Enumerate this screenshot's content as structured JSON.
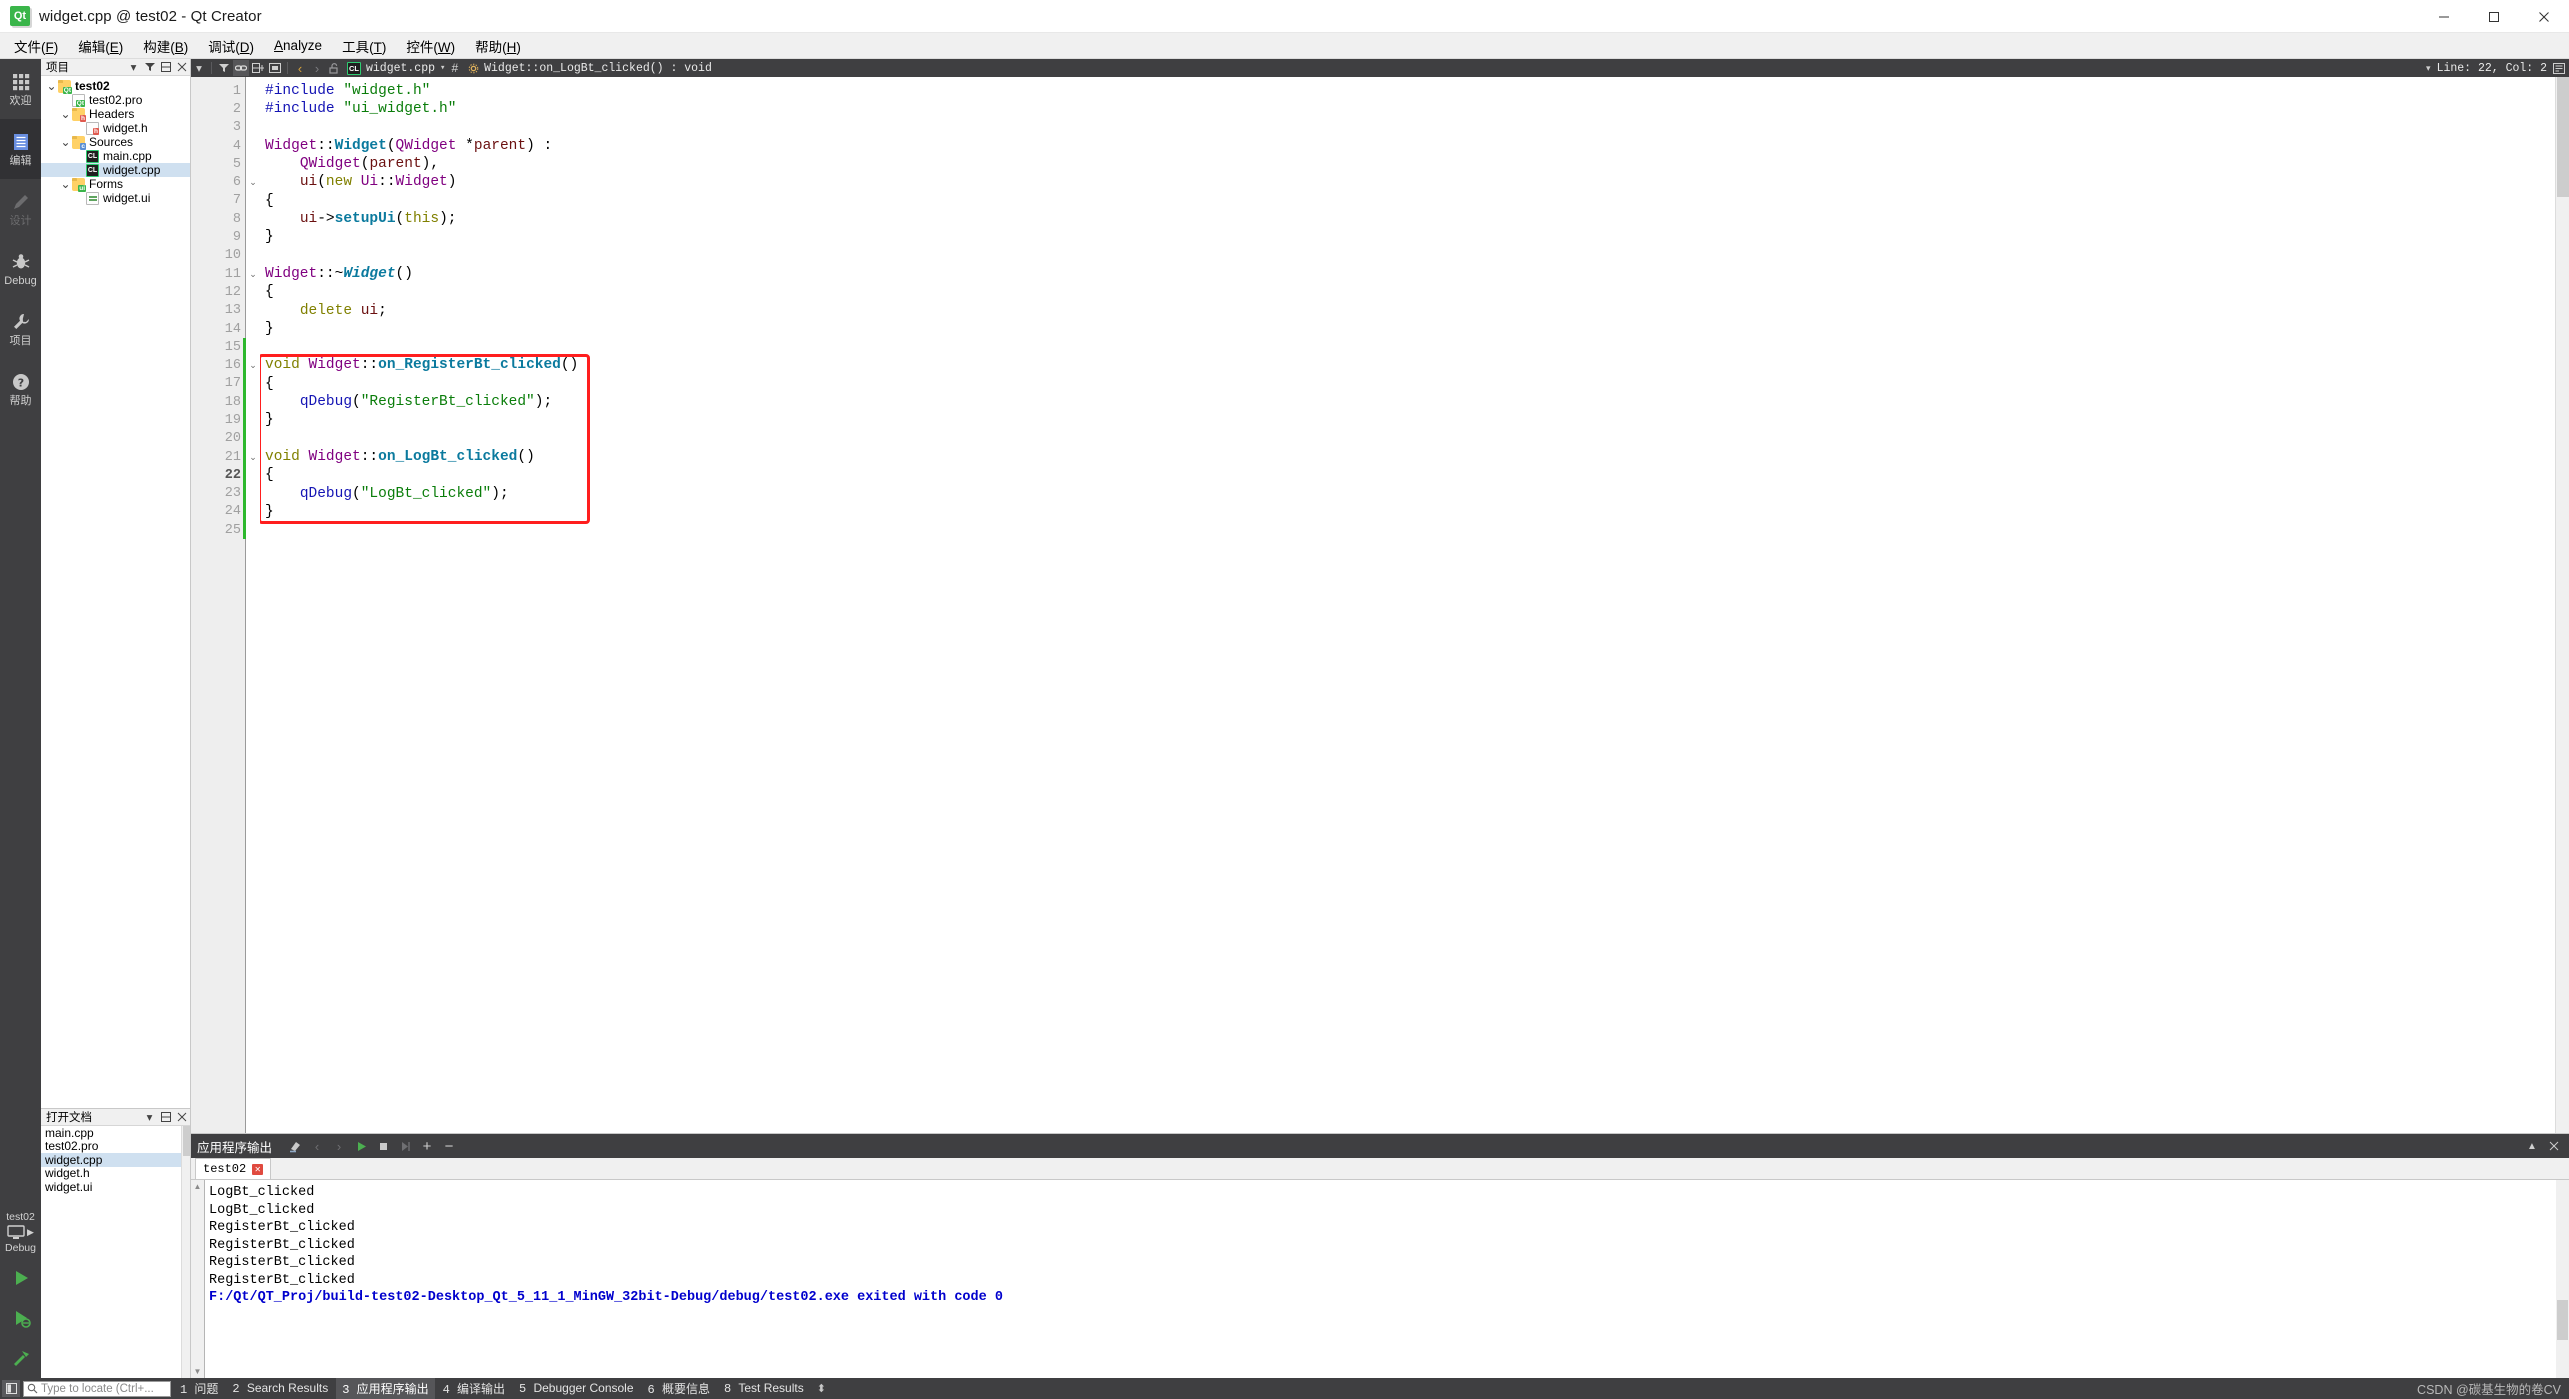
{
  "window": {
    "title": "widget.cpp @ test02 - Qt Creator",
    "app_icon": "qt-logo-icon",
    "minimize": "minimize-icon",
    "maximize": "maximize-icon",
    "close": "close-icon"
  },
  "menubar": {
    "items": [
      {
        "label": "文件(F)",
        "text": "文件(",
        "mnemonic": "F",
        "tail": ")"
      },
      {
        "label": "编辑(E)",
        "text": "编辑(",
        "mnemonic": "E",
        "tail": ")"
      },
      {
        "label": "构建(B)",
        "text": "构建(",
        "mnemonic": "B",
        "tail": ")"
      },
      {
        "label": "调试(D)",
        "text": "调试(",
        "mnemonic": "D",
        "tail": ")"
      },
      {
        "label": "Analyze",
        "text": "",
        "mnemonic": "A",
        "tail": "nalyze"
      },
      {
        "label": "工具(T)",
        "text": "工具(",
        "mnemonic": "T",
        "tail": ")"
      },
      {
        "label": "控件(W)",
        "text": "控件(",
        "mnemonic": "W",
        "tail": ")"
      },
      {
        "label": "帮助(H)",
        "text": "帮助(",
        "mnemonic": "H",
        "tail": ")"
      }
    ]
  },
  "modebar": {
    "items": [
      {
        "label": "欢迎",
        "icon": "grid-icon",
        "state": "normal"
      },
      {
        "label": "编辑",
        "icon": "document-icon",
        "state": "active"
      },
      {
        "label": "设计",
        "icon": "pencil-icon",
        "state": "disabled"
      },
      {
        "label": "Debug",
        "icon": "bug-icon",
        "state": "normal"
      },
      {
        "label": "项目",
        "icon": "wrench-icon",
        "state": "normal"
      },
      {
        "label": "帮助",
        "icon": "question-icon",
        "state": "normal"
      }
    ],
    "kit": {
      "project": "test02",
      "icon": "desktop-icon",
      "config": "Debug",
      "run_icon": "run-icon",
      "debug_icon": "debug-run-icon",
      "build_icon": "build-hammer-icon"
    }
  },
  "projects_pane": {
    "title": "项目",
    "filter_icon": "filter-icon",
    "dropdown_icon": "chevron-down-icon",
    "split_icon": "split-icon",
    "close_icon": "close-icon",
    "tree": [
      {
        "label": "test02",
        "depth": 0,
        "icon": "folder-qt-icon",
        "arrow": "down",
        "bold": true,
        "selected": false
      },
      {
        "label": "test02.pro",
        "depth": 1,
        "icon": "file-pro-icon",
        "arrow": "none",
        "bold": false,
        "selected": false
      },
      {
        "label": "Headers",
        "depth": 1,
        "icon": "folder-h-icon",
        "arrow": "down",
        "bold": false,
        "selected": false
      },
      {
        "label": "widget.h",
        "depth": 2,
        "icon": "file-h-icon",
        "arrow": "none",
        "bold": false,
        "selected": false
      },
      {
        "label": "Sources",
        "depth": 1,
        "icon": "folder-cpp-icon",
        "arrow": "down",
        "bold": false,
        "selected": false
      },
      {
        "label": "main.cpp",
        "depth": 2,
        "icon": "file-cl-icon",
        "arrow": "none",
        "bold": false,
        "selected": false
      },
      {
        "label": "widget.cpp",
        "depth": 2,
        "icon": "file-cl-icon",
        "arrow": "none",
        "bold": false,
        "selected": true
      },
      {
        "label": "Forms",
        "depth": 1,
        "icon": "folder-ui-icon",
        "arrow": "down",
        "bold": false,
        "selected": false
      },
      {
        "label": "widget.ui",
        "depth": 2,
        "icon": "file-ui-icon",
        "arrow": "none",
        "bold": false,
        "selected": false
      }
    ]
  },
  "open_documents": {
    "title": "打开文档",
    "dropdown_icon": "chevron-down-icon",
    "split_icon": "split-icon",
    "close_icon": "close-icon",
    "items": [
      {
        "label": "main.cpp",
        "selected": false
      },
      {
        "label": "test02.pro",
        "selected": false
      },
      {
        "label": "widget.cpp",
        "selected": true
      },
      {
        "label": "widget.h",
        "selected": false
      },
      {
        "label": "widget.ui",
        "selected": false
      }
    ]
  },
  "editor_toolbar": {
    "dropdown_icon": "chevron-down-icon",
    "filter_icon": "filter-icon",
    "link_icon": "link-icon",
    "split_icon": "split-horizontal-icon",
    "close_split_icon": "close-split-icon",
    "back_icon": "back-arrow-icon",
    "forward_icon": "forward-arrow-icon",
    "lock_icon": "unlocked-icon",
    "file_icon": "cl-file-icon",
    "filename": "widget.cpp",
    "separator": "#",
    "symbol": "Widget::on_LogBt_clicked() : void",
    "line_col": "Line: 22, Col: 2",
    "right_dropdown_icon": "chevron-down-icon",
    "outline_icon": "outline-icon"
  },
  "code": {
    "cursor_line": 22,
    "first_line": 1,
    "last_line": 25,
    "changed_lines": [
      15,
      16,
      17,
      18,
      19,
      20,
      21,
      22,
      23,
      24,
      25
    ],
    "fold_lines": [
      6,
      11,
      16,
      21
    ],
    "lines": [
      {
        "n": 1,
        "tokens": [
          {
            "t": "#include ",
            "c": "t-pre"
          },
          {
            "t": "\"widget.h\"",
            "c": "t-str"
          }
        ]
      },
      {
        "n": 2,
        "tokens": [
          {
            "t": "#include ",
            "c": "t-pre"
          },
          {
            "t": "\"ui_widget.h\"",
            "c": "t-str"
          }
        ]
      },
      {
        "n": 3,
        "tokens": []
      },
      {
        "n": 4,
        "tokens": [
          {
            "t": "Widget",
            "c": "t-type"
          },
          {
            "t": "::",
            "c": "t-op"
          },
          {
            "t": "Widget",
            "c": "t-func"
          },
          {
            "t": "(",
            "c": "t-op"
          },
          {
            "t": "QWidget",
            "c": "t-type"
          },
          {
            "t": " *",
            "c": "t-op"
          },
          {
            "t": "parent",
            "c": "t-var"
          },
          {
            "t": ") :",
            "c": "t-op"
          }
        ]
      },
      {
        "n": 5,
        "tokens": [
          {
            "t": "    ",
            "c": "t-plain"
          },
          {
            "t": "QWidget",
            "c": "t-type"
          },
          {
            "t": "(",
            "c": "t-op"
          },
          {
            "t": "parent",
            "c": "t-var"
          },
          {
            "t": "),",
            "c": "t-op"
          }
        ]
      },
      {
        "n": 6,
        "tokens": [
          {
            "t": "    ",
            "c": "t-plain"
          },
          {
            "t": "ui",
            "c": "t-var"
          },
          {
            "t": "(",
            "c": "t-op"
          },
          {
            "t": "new",
            "c": "t-kw"
          },
          {
            "t": " ",
            "c": "t-plain"
          },
          {
            "t": "Ui",
            "c": "t-type"
          },
          {
            "t": "::",
            "c": "t-op"
          },
          {
            "t": "Widget",
            "c": "t-type"
          },
          {
            "t": ")",
            "c": "t-op"
          }
        ]
      },
      {
        "n": 7,
        "tokens": [
          {
            "t": "{",
            "c": "t-op"
          }
        ]
      },
      {
        "n": 8,
        "tokens": [
          {
            "t": "    ",
            "c": "t-plain"
          },
          {
            "t": "ui",
            "c": "t-var"
          },
          {
            "t": "->",
            "c": "t-op"
          },
          {
            "t": "setupUi",
            "c": "t-func"
          },
          {
            "t": "(",
            "c": "t-op"
          },
          {
            "t": "this",
            "c": "t-kw"
          },
          {
            "t": ");",
            "c": "t-op"
          }
        ]
      },
      {
        "n": 9,
        "tokens": [
          {
            "t": "}",
            "c": "t-op"
          }
        ]
      },
      {
        "n": 10,
        "tokens": []
      },
      {
        "n": 11,
        "tokens": [
          {
            "t": "Widget",
            "c": "t-type"
          },
          {
            "t": "::~",
            "c": "t-op"
          },
          {
            "t": "Widget",
            "c": "t-funcd"
          },
          {
            "t": "()",
            "c": "t-op"
          }
        ]
      },
      {
        "n": 12,
        "tokens": [
          {
            "t": "{",
            "c": "t-op"
          }
        ]
      },
      {
        "n": 13,
        "tokens": [
          {
            "t": "    ",
            "c": "t-plain"
          },
          {
            "t": "delete",
            "c": "t-kw"
          },
          {
            "t": " ",
            "c": "t-plain"
          },
          {
            "t": "ui",
            "c": "t-var"
          },
          {
            "t": ";",
            "c": "t-op"
          }
        ]
      },
      {
        "n": 14,
        "tokens": [
          {
            "t": "}",
            "c": "t-op"
          }
        ]
      },
      {
        "n": 15,
        "tokens": []
      },
      {
        "n": 16,
        "tokens": [
          {
            "t": "void",
            "c": "t-kw"
          },
          {
            "t": " ",
            "c": "t-plain"
          },
          {
            "t": "Widget",
            "c": "t-type"
          },
          {
            "t": "::",
            "c": "t-op"
          },
          {
            "t": "on_RegisterBt_clicked",
            "c": "t-func"
          },
          {
            "t": "()",
            "c": "t-op"
          }
        ]
      },
      {
        "n": 17,
        "tokens": [
          {
            "t": "{",
            "c": "t-op"
          }
        ]
      },
      {
        "n": 18,
        "tokens": [
          {
            "t": "    ",
            "c": "t-plain"
          },
          {
            "t": "qDebug",
            "c": "t-pre"
          },
          {
            "t": "(",
            "c": "t-op"
          },
          {
            "t": "\"RegisterBt_clicked\"",
            "c": "t-str"
          },
          {
            "t": ");",
            "c": "t-op"
          }
        ]
      },
      {
        "n": 19,
        "tokens": [
          {
            "t": "}",
            "c": "t-op"
          }
        ]
      },
      {
        "n": 20,
        "tokens": []
      },
      {
        "n": 21,
        "tokens": [
          {
            "t": "void",
            "c": "t-kw"
          },
          {
            "t": " ",
            "c": "t-plain"
          },
          {
            "t": "Widget",
            "c": "t-type"
          },
          {
            "t": "::",
            "c": "t-op"
          },
          {
            "t": "on_LogBt_clicked",
            "c": "t-func"
          },
          {
            "t": "()",
            "c": "t-op"
          }
        ]
      },
      {
        "n": 22,
        "tokens": [
          {
            "t": "{",
            "c": "t-op"
          }
        ]
      },
      {
        "n": 23,
        "tokens": [
          {
            "t": "    ",
            "c": "t-plain"
          },
          {
            "t": "qDebug",
            "c": "t-pre"
          },
          {
            "t": "(",
            "c": "t-op"
          },
          {
            "t": "\"LogBt_clicked\"",
            "c": "t-str"
          },
          {
            "t": ");",
            "c": "t-op"
          }
        ]
      },
      {
        "n": 24,
        "tokens": [
          {
            "t": "}",
            "c": "t-op"
          }
        ]
      },
      {
        "n": 25,
        "tokens": []
      }
    ],
    "annotation_box": {
      "color": "#ff1e1e",
      "from_line": 16,
      "to_line": 24
    }
  },
  "output_pane": {
    "title": "应用程序输出",
    "tools": [
      {
        "icon": "clear-icon",
        "state": "normal"
      },
      {
        "icon": "prev-icon",
        "state": "disabled"
      },
      {
        "icon": "next-icon",
        "state": "disabled"
      },
      {
        "icon": "run-icon",
        "state": "normal"
      },
      {
        "icon": "stop-icon",
        "state": "normal"
      },
      {
        "icon": "attach-icon",
        "state": "disabled"
      },
      {
        "icon": "zoom-in-icon",
        "state": "normal"
      },
      {
        "icon": "zoom-out-icon",
        "state": "normal"
      }
    ],
    "maximize_icon": "maximize-pane-icon",
    "close_icon": "close-pane-icon",
    "tab": {
      "label": "test02",
      "close_icon": "close-tab-icon"
    },
    "lines": [
      {
        "text": "LogBt_clicked",
        "kind": "normal"
      },
      {
        "text": "LogBt_clicked",
        "kind": "normal"
      },
      {
        "text": "RegisterBt_clicked",
        "kind": "normal"
      },
      {
        "text": "RegisterBt_clicked",
        "kind": "normal"
      },
      {
        "text": "RegisterBt_clicked",
        "kind": "normal"
      },
      {
        "text": "RegisterBt_clicked",
        "kind": "normal"
      },
      {
        "text": "F:/Qt/QT_Proj/build-test02-Desktop_Qt_5_11_1_MinGW_32bit-Debug/debug/test02.exe exited with code 0",
        "kind": "exit"
      }
    ]
  },
  "statusbar": {
    "toggle_icon": "toggle-sidebar-icon",
    "locator": {
      "icon": "search-icon",
      "placeholder": "Type to locate (Ctrl+...",
      "value": ""
    },
    "items": [
      {
        "num": "1",
        "label": "问题",
        "active": false
      },
      {
        "num": "2",
        "label": "Search Results",
        "active": false
      },
      {
        "num": "3",
        "label": "应用程序输出",
        "active": true
      },
      {
        "num": "4",
        "label": "编译输出",
        "active": false
      },
      {
        "num": "5",
        "label": "Debugger Console",
        "active": false
      },
      {
        "num": "6",
        "label": "概要信息",
        "active": false
      },
      {
        "num": "8",
        "label": "Test Results",
        "active": false
      }
    ],
    "spinner_icon": "updown-icon",
    "watermark": "CSDN @碳基生物的卷CV"
  },
  "colors": {
    "dark_chrome": "#3f3f41",
    "accent_green": "#3ab54a",
    "annotation_red": "#ff1e1e",
    "selection_blue": "#cfe0f0",
    "change_green": "#2db82d",
    "exit_blue": "#0000cd"
  }
}
